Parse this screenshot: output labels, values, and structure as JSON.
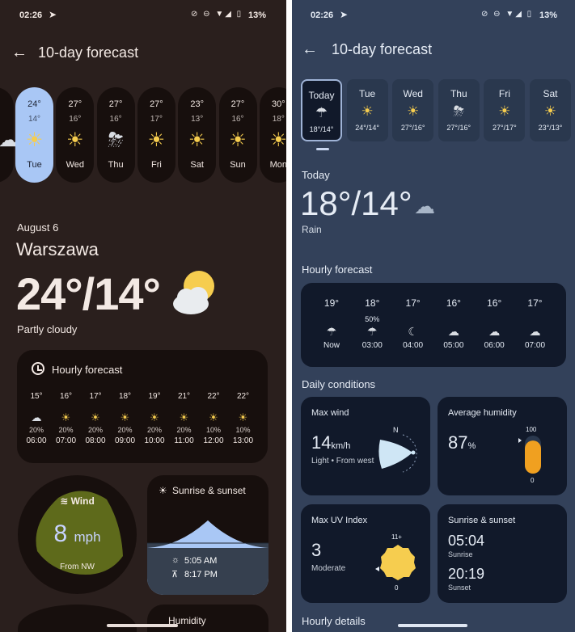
{
  "left": {
    "status": {
      "time": "02:26",
      "battery": "13%"
    },
    "title": "10-day forecast",
    "days": [
      {
        "hi": "24°",
        "lo": "14°",
        "name": "Tue",
        "icon": "partly-cloudy-icon",
        "selected": true
      },
      {
        "hi": "27°",
        "lo": "16°",
        "name": "Wed",
        "icon": "partly-cloudy-icon"
      },
      {
        "hi": "27°",
        "lo": "16°",
        "name": "Thu",
        "icon": "thunderstorm-icon"
      },
      {
        "hi": "27°",
        "lo": "17°",
        "name": "Fri",
        "icon": "partly-cloudy-icon"
      },
      {
        "hi": "23°",
        "lo": "13°",
        "name": "Sat",
        "icon": "partly-cloudy-icon"
      },
      {
        "hi": "27°",
        "lo": "16°",
        "name": "Sun",
        "icon": "partly-cloudy-icon"
      },
      {
        "hi": "30°",
        "lo": "18°",
        "name": "Mon",
        "icon": "partly-cloudy-icon"
      }
    ],
    "date": "August 6",
    "city": "Warszawa",
    "temp": "24°/14°",
    "condition": "Partly cloudy",
    "hourly": {
      "title": "Hourly forecast",
      "items": [
        {
          "temp": "15°",
          "precip": "20%",
          "time": "06:00",
          "icon": "cloudy-icon"
        },
        {
          "temp": "16°",
          "precip": "20%",
          "time": "07:00",
          "icon": "partly-cloudy-icon"
        },
        {
          "temp": "17°",
          "precip": "20%",
          "time": "08:00",
          "icon": "partly-cloudy-icon"
        },
        {
          "temp": "18°",
          "precip": "20%",
          "time": "09:00",
          "icon": "partly-cloudy-icon"
        },
        {
          "temp": "19°",
          "precip": "20%",
          "time": "10:00",
          "icon": "partly-cloudy-icon"
        },
        {
          "temp": "21°",
          "precip": "20%",
          "time": "11:00",
          "icon": "partly-cloudy-icon"
        },
        {
          "temp": "22°",
          "precip": "10%",
          "time": "12:00",
          "icon": "partly-cloudy-icon"
        },
        {
          "temp": "22°",
          "precip": "10%",
          "time": "13:00",
          "icon": "partly-cloudy-icon"
        }
      ]
    },
    "wind": {
      "title": "Wind",
      "value": "8",
      "unit": "mph",
      "from": "From NW"
    },
    "sun": {
      "title": "Sunrise & sunset",
      "sunrise": "5:05 AM",
      "sunset": "8:17 PM"
    },
    "peek": "Humidity"
  },
  "right": {
    "status": {
      "time": "02:26",
      "battery": "13%"
    },
    "title": "10-day forecast",
    "days": [
      {
        "name": "Today",
        "range": "18°/14°",
        "icon": "rain-icon",
        "selected": true
      },
      {
        "name": "Tue",
        "range": "24°/14°",
        "icon": "partly-cloudy-icon"
      },
      {
        "name": "Wed",
        "range": "27°/16°",
        "icon": "partly-cloudy-icon"
      },
      {
        "name": "Thu",
        "range": "27°/16°",
        "icon": "thunderstorm-icon"
      },
      {
        "name": "Fri",
        "range": "27°/17°",
        "icon": "partly-cloudy-icon"
      },
      {
        "name": "Sat",
        "range": "23°/13°",
        "icon": "partly-cloudy-icon"
      }
    ],
    "today_label": "Today",
    "temp": "18°/14°",
    "condition": "Rain",
    "hourly": {
      "title": "Hourly forecast",
      "items": [
        {
          "temp": "19°",
          "precip": "",
          "time": "Now",
          "icon": "rain-icon"
        },
        {
          "temp": "18°",
          "precip": "50%",
          "time": "03:00",
          "icon": "rain-icon"
        },
        {
          "temp": "17°",
          "precip": "",
          "time": "04:00",
          "icon": "night-cloudy-icon"
        },
        {
          "temp": "16°",
          "precip": "",
          "time": "05:00",
          "icon": "cloudy-icon"
        },
        {
          "temp": "16°",
          "precip": "",
          "time": "06:00",
          "icon": "cloudy-icon"
        },
        {
          "temp": "17°",
          "precip": "",
          "time": "07:00",
          "icon": "cloudy-icon"
        }
      ]
    },
    "daily_title": "Daily conditions",
    "max_wind": {
      "title": "Max wind",
      "value": "14",
      "unit": "km/h",
      "sub": "Light • From west",
      "compass": "N"
    },
    "humidity": {
      "title": "Average humidity",
      "value": "87",
      "unit": "%",
      "max": "100",
      "min": "0",
      "level": 0.87
    },
    "uv": {
      "title": "Max UV Index",
      "value": "3",
      "sub": "Moderate",
      "max": "11+",
      "min": "0"
    },
    "sunrise_sunset": {
      "title": "Sunrise & sunset",
      "sunrise": "05:04",
      "sunrise_label": "Sunrise",
      "sunset": "20:19",
      "sunset_label": "Sunset"
    },
    "peek": "Hourly details"
  },
  "colors": {
    "left_bg": "#2a1f1d",
    "right_bg": "#33415a",
    "selected_day": "#a9c7f5",
    "humidity_fill": "#f0a020",
    "uv_sun": "#f6cd4f",
    "wind_blob": "#6b7a1f"
  }
}
